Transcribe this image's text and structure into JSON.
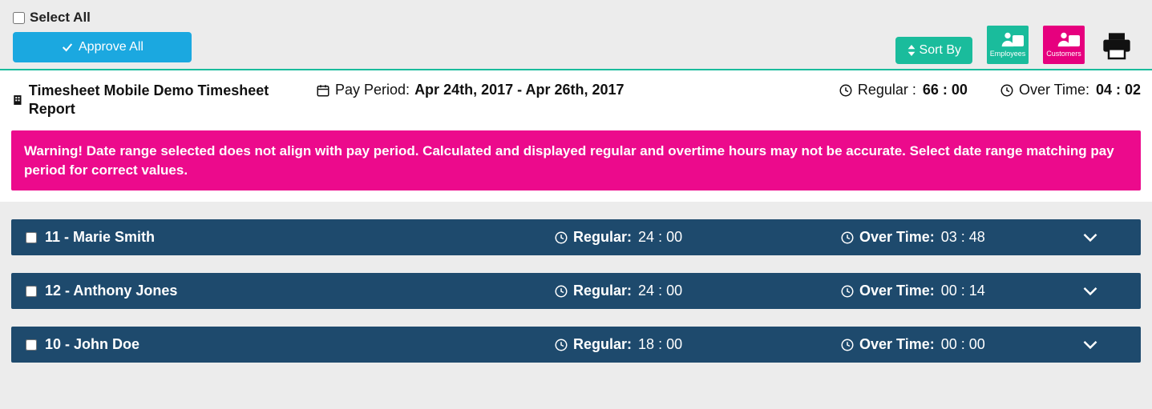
{
  "controls": {
    "select_all_label": "Select All",
    "approve_all_label": "Approve All",
    "sort_by_label": "Sort By",
    "export_employees_label": "Employees",
    "export_customers_label": "Customers"
  },
  "summary": {
    "title": "Timesheet Mobile Demo Timesheet Report",
    "pay_period_label": "Pay Period:",
    "pay_period_value": "Apr 24th, 2017 - Apr 26th, 2017",
    "regular_label": "Regular :",
    "regular_value": "66 : 00",
    "overtime_label": "Over Time:",
    "overtime_value": "04 : 02"
  },
  "warning": "Warning! Date range selected does not align with pay period. Calculated and displayed regular and overtime hours may not be accurate. Select date range matching pay period for correct values.",
  "labels": {
    "regular": "Regular:",
    "overtime": "Over Time:"
  },
  "employees": [
    {
      "name": "11 - Marie Smith",
      "regular": "24 : 00",
      "overtime": "03 : 48"
    },
    {
      "name": "12 - Anthony Jones",
      "regular": "24 : 00",
      "overtime": "00 : 14"
    },
    {
      "name": "10 - John Doe",
      "regular": "18 : 00",
      "overtime": "00 : 00"
    }
  ]
}
